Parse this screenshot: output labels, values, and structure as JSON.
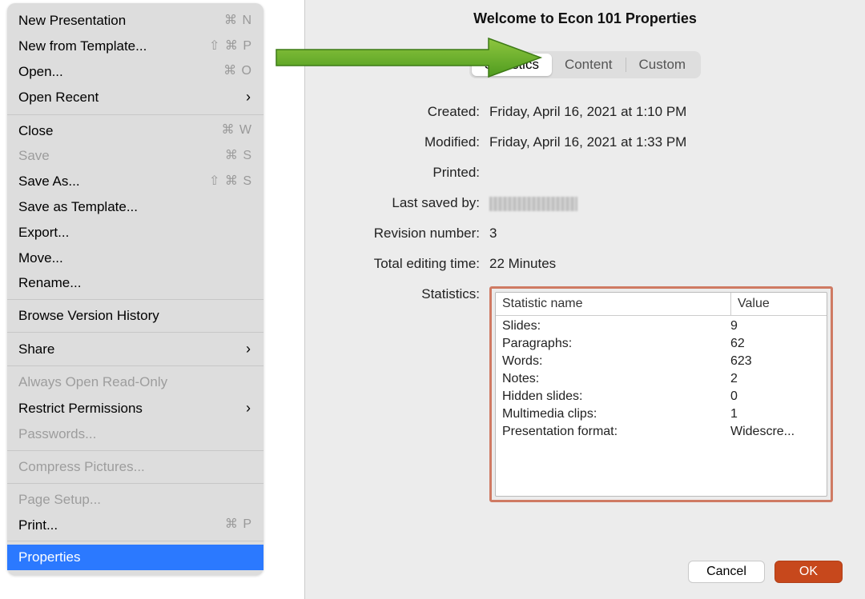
{
  "menu": {
    "items": [
      {
        "label": "New Presentation",
        "shortcut": "⌘ N",
        "sub": false,
        "enabled": true
      },
      {
        "label": "New from Template...",
        "shortcut": "⇧ ⌘ P",
        "sub": false,
        "enabled": true
      },
      {
        "label": "Open...",
        "shortcut": "⌘ O",
        "sub": false,
        "enabled": true
      },
      {
        "label": "Open Recent",
        "shortcut": "",
        "sub": true,
        "enabled": true
      },
      {
        "sep": true
      },
      {
        "label": "Close",
        "shortcut": "⌘ W",
        "sub": false,
        "enabled": true
      },
      {
        "label": "Save",
        "shortcut": "⌘ S",
        "sub": false,
        "enabled": false
      },
      {
        "label": "Save As...",
        "shortcut": "⇧ ⌘ S",
        "sub": false,
        "enabled": true
      },
      {
        "label": "Save as Template...",
        "shortcut": "",
        "sub": false,
        "enabled": true
      },
      {
        "label": "Export...",
        "shortcut": "",
        "sub": false,
        "enabled": true
      },
      {
        "label": "Move...",
        "shortcut": "",
        "sub": false,
        "enabled": true
      },
      {
        "label": "Rename...",
        "shortcut": "",
        "sub": false,
        "enabled": true
      },
      {
        "sep": true
      },
      {
        "label": "Browse Version History",
        "shortcut": "",
        "sub": false,
        "enabled": true
      },
      {
        "sep": true
      },
      {
        "label": "Share",
        "shortcut": "",
        "sub": true,
        "enabled": true
      },
      {
        "sep": true
      },
      {
        "label": "Always Open Read-Only",
        "shortcut": "",
        "sub": false,
        "enabled": false
      },
      {
        "label": "Restrict Permissions",
        "shortcut": "",
        "sub": true,
        "enabled": true
      },
      {
        "label": "Passwords...",
        "shortcut": "",
        "sub": false,
        "enabled": false
      },
      {
        "sep": true
      },
      {
        "label": "Compress Pictures...",
        "shortcut": "",
        "sub": false,
        "enabled": false
      },
      {
        "sep": true
      },
      {
        "label": "Page Setup...",
        "shortcut": "",
        "sub": false,
        "enabled": false
      },
      {
        "label": "Print...",
        "shortcut": "⌘ P",
        "sub": false,
        "enabled": true
      },
      {
        "sep": true
      },
      {
        "label": "Properties",
        "shortcut": "",
        "sub": false,
        "enabled": true,
        "selected": true
      }
    ]
  },
  "sheet": {
    "title": "Welcome to Econ 101 Properties",
    "tabs": {
      "statistics": "Statistics",
      "content": "Content",
      "custom": "Custom"
    },
    "fields": {
      "created_label": "Created:",
      "created_value": "Friday, April 16, 2021 at 1:10 PM",
      "modified_label": "Modified:",
      "modified_value": "Friday, April 16, 2021 at 1:33 PM",
      "printed_label": "Printed:",
      "printed_value": "",
      "saved_by_label": "Last saved by:",
      "revision_label": "Revision number:",
      "revision_value": "3",
      "editing_label": "Total editing time:",
      "editing_value": "22 Minutes",
      "stats_label": "Statistics:"
    },
    "stats": {
      "head_name": "Statistic name",
      "head_value": "Value",
      "rows": [
        {
          "name": "Slides:",
          "value": "9"
        },
        {
          "name": "Paragraphs:",
          "value": "62"
        },
        {
          "name": "Words:",
          "value": "623"
        },
        {
          "name": "Notes:",
          "value": "2"
        },
        {
          "name": "Hidden slides:",
          "value": "0"
        },
        {
          "name": "Multimedia clips:",
          "value": "1"
        },
        {
          "name": "Presentation format:",
          "value": "Widescre..."
        }
      ]
    },
    "buttons": {
      "cancel": "Cancel",
      "ok": "OK"
    }
  }
}
